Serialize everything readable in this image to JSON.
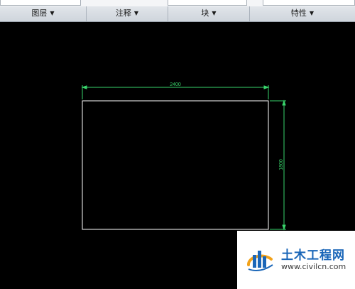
{
  "ribbon": {
    "panels": [
      {
        "label": "图层"
      },
      {
        "label": "注释"
      },
      {
        "label": "块"
      },
      {
        "label": "特性"
      }
    ]
  },
  "drawing": {
    "dim_horizontal": "2400",
    "dim_vertical": "1800",
    "line_color": "#ffffff",
    "dim_color": "#39d46b"
  },
  "watermark": {
    "name": "土木工程网",
    "url": "www.civilcn.com"
  }
}
